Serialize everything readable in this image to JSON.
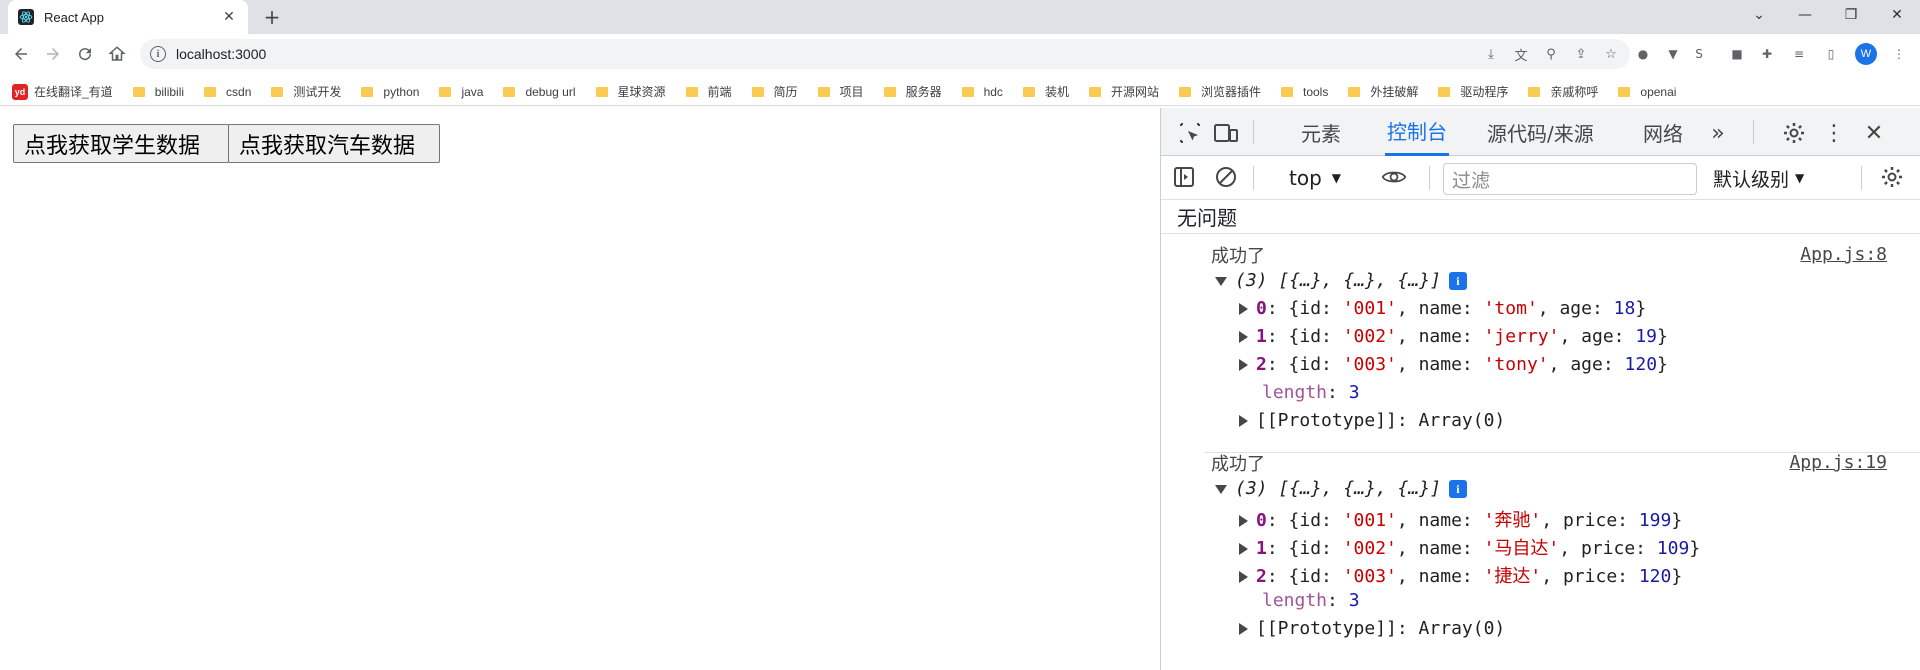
{
  "browser": {
    "tab": {
      "title": "React App",
      "close": "✕"
    },
    "new_tab": "+",
    "window_controls": [
      "⌄",
      "—",
      "❐",
      "✕"
    ],
    "url": "localhost:3000"
  },
  "bookmarks": [
    "在线翻译_有道",
    "bilibili",
    "csdn",
    "测试开发",
    "python",
    "java",
    "debug url",
    "星球资源",
    "前端",
    "简历",
    "项目",
    "服务器",
    "hdc",
    "装机",
    "开源网站",
    "浏览器插件",
    "tools",
    "外挂破解",
    "驱动程序",
    "亲戚称呼",
    "openai"
  ],
  "page": {
    "buttons": [
      "点我获取学生数据",
      "点我获取汽车数据"
    ]
  },
  "devtools": {
    "tabs": [
      "元素",
      "控制台",
      "源代码/来源",
      "网络"
    ],
    "active_tab": "控制台",
    "context": "top",
    "filter_placeholder": "过滤",
    "level": "默认级别",
    "issues": "无问题",
    "logs": [
      {
        "message": "成功了",
        "source": "App.js:8",
        "summary": "(3) [{…}, {…}, {…}]",
        "items": [
          {
            "idx": "0",
            "id": "'001'",
            "name": "'tom'",
            "third_key": "age",
            "third_val": "18"
          },
          {
            "idx": "1",
            "id": "'002'",
            "name": "'jerry'",
            "third_key": "age",
            "third_val": "19"
          },
          {
            "idx": "2",
            "id": "'003'",
            "name": "'tony'",
            "third_key": "age",
            "third_val": "120"
          }
        ],
        "length_label": "length",
        "length_val": "3",
        "proto": "[[Prototype]]: Array(0)"
      },
      {
        "message": "成功了",
        "source": "App.js:19",
        "summary": "(3) [{…}, {…}, {…}]",
        "items": [
          {
            "idx": "0",
            "id": "'001'",
            "name": "'奔驰'",
            "third_key": "price",
            "third_val": "199"
          },
          {
            "idx": "1",
            "id": "'002'",
            "name": "'马自达'",
            "third_key": "price",
            "third_val": "109"
          },
          {
            "idx": "2",
            "id": "'003'",
            "name": "'捷达'",
            "third_key": "price",
            "third_val": "120"
          }
        ],
        "length_label": "length",
        "length_val": "3",
        "proto": "[[Prototype]]: Array(0)"
      }
    ]
  }
}
